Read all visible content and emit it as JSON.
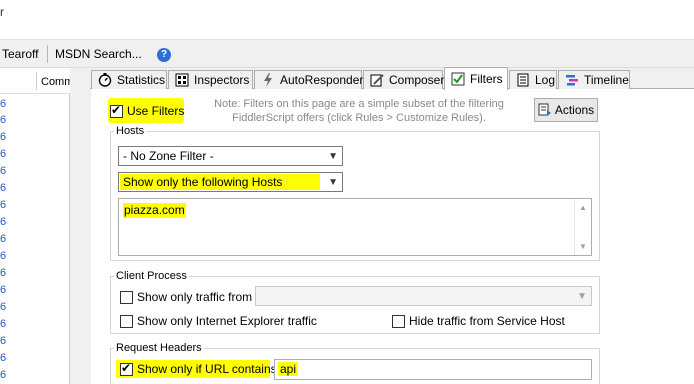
{
  "topbar": {
    "glyph": "r"
  },
  "toolbar": {
    "tearoff_label": "Tearoff",
    "msdn_search_label": "MSDN Search...",
    "help_glyph": "?"
  },
  "sessions": {
    "header_label": "Comm",
    "row_number": "6"
  },
  "tabs": [
    {
      "label": "Statistics",
      "icon": "stopwatch-icon"
    },
    {
      "label": "Inspectors",
      "icon": "inspectors-icon"
    },
    {
      "label": "AutoResponder",
      "icon": "lightning-icon"
    },
    {
      "label": "Composer",
      "icon": "composer-icon"
    },
    {
      "label": "Filters",
      "icon": "checkbox-icon",
      "active": true
    },
    {
      "label": "Log",
      "icon": "log-icon"
    },
    {
      "label": "Timeline",
      "icon": "timeline-icon"
    }
  ],
  "filters": {
    "use_filters_label": "Use Filters",
    "use_filters_checked": true,
    "note_line1": "Note: Filters on this page are a simple subset of the filtering",
    "note_line2": "FiddlerScript offers (click Rules > Customize Rules).",
    "actions_label": "Actions",
    "hosts": {
      "legend": "Hosts",
      "zone_filter": "- No Zone Filter -",
      "host_filter": "Show only the following Hosts",
      "hosts_list": "piazza.com"
    },
    "client_process": {
      "legend": "Client Process",
      "show_only_traffic_from": "Show only traffic from",
      "show_only_ie": "Show only Internet Explorer traffic",
      "hide_service_host": "Hide traffic from Service Host"
    },
    "request_headers": {
      "legend": "Request Headers",
      "url_contains_label": "Show only if URL contains",
      "url_contains_checked": true,
      "url_contains_value": "api"
    }
  },
  "colors": {
    "highlight": "#ffff00",
    "link_blue": "#2a56c6",
    "help_blue": "#2e6fd6"
  }
}
